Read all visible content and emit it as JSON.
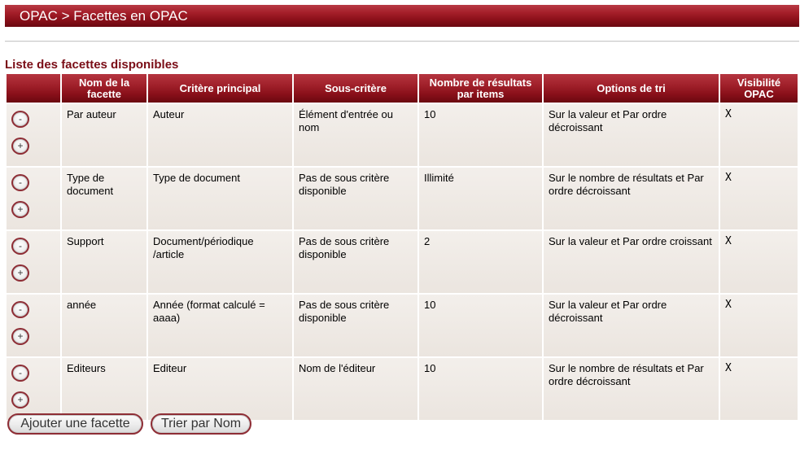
{
  "header": {
    "title": "OPAC > Facettes en OPAC"
  },
  "section": {
    "title": "Liste des facettes disponibles"
  },
  "table": {
    "columns": [
      "",
      "Nom de la facette",
      "Critère principal",
      "Sous-critère",
      "Nombre de résultats par items",
      "Options de tri",
      "Visibilité OPAC"
    ],
    "rows": [
      {
        "name": "Par auteur",
        "criterion": "Auteur",
        "subcriterion": "Élément d'entrée ou nom",
        "count": "10",
        "sort": "Sur la valeur et Par ordre décroissant",
        "visible": "X"
      },
      {
        "name": "Type de document",
        "criterion": "Type de document",
        "subcriterion": "Pas de sous critère disponible",
        "count": "Illimité",
        "sort": "Sur le nombre de résultats et Par ordre décroissant",
        "visible": "X"
      },
      {
        "name": "Support",
        "criterion": "Document/périodique /article",
        "subcriterion": "Pas de sous critère disponible",
        "count": "2",
        "sort": "Sur la valeur et Par ordre croissant",
        "visible": "X"
      },
      {
        "name": "année",
        "criterion": "Année (format calculé = aaaa)",
        "subcriterion": "Pas de sous critère disponible",
        "count": "10",
        "sort": "Sur la valeur et Par ordre décroissant",
        "visible": "X"
      },
      {
        "name": "Editeurs",
        "criterion": "Editeur",
        "subcriterion": "Nom de l'éditeur",
        "count": "10",
        "sort": "Sur le nombre de résultats et Par ordre décroissant",
        "visible": "X"
      }
    ],
    "move_up_label": "-",
    "move_down_label": "+"
  },
  "actions": {
    "add_label": "Ajouter une facette",
    "sort_label": "Trier par Nom"
  },
  "colors": {
    "accent": "#a51f2a",
    "section_title": "#7a0d16",
    "cell_bg": "#ede7e1"
  }
}
